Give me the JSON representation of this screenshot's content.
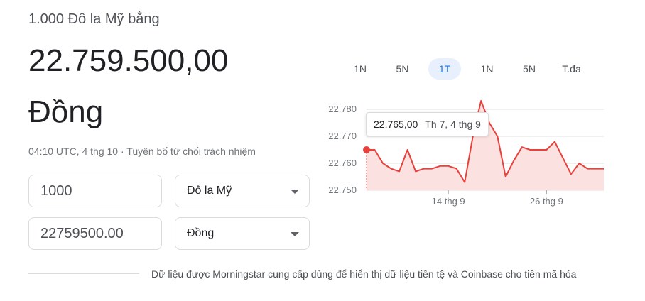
{
  "header": {
    "subtitle": "1.000 Đô la Mỹ bằng",
    "amount": "22.759.500,00",
    "currency_name": "Đồng"
  },
  "meta": {
    "timestamp": "04:10 UTC, 4 thg 10",
    "separator": " · ",
    "disclaimer": "Tuyên bố từ chối trách nhiệm"
  },
  "converter": {
    "from_value": "1000",
    "from_currency": "Đô la Mỹ",
    "to_value": "22759500.00",
    "to_currency": "Đồng"
  },
  "range_tabs": [
    {
      "label": "1N",
      "active": false
    },
    {
      "label": "5N",
      "active": false
    },
    {
      "label": "1T",
      "active": true
    },
    {
      "label": "1N",
      "active": false
    },
    {
      "label": "5N",
      "active": false
    },
    {
      "label": "T.đa",
      "active": false
    }
  ],
  "tooltip": {
    "value": "22.765,00",
    "date": "Th 7, 4 thg 9"
  },
  "colors": {
    "line": "#e8413c",
    "fill": "#fbe1df",
    "accent": "#1a73e8",
    "grid": "#e0e0e0"
  },
  "chart_data": {
    "type": "area",
    "y_tick_labels": [
      "22.780",
      "22.770",
      "22.760",
      "22.750"
    ],
    "y_ticks": [
      22780,
      22770,
      22760,
      22750
    ],
    "x_tick_labels": [
      "14 thg 9",
      "26 thg 9"
    ],
    "x_tick_index": [
      10,
      22
    ],
    "ylim": [
      22750,
      22780
    ],
    "values": [
      22765,
      22765,
      22760,
      22758,
      22757,
      22765,
      22757,
      22758,
      22758,
      22759,
      22759,
      22758,
      22753,
      22770,
      22785,
      22775,
      22770,
      22755,
      22761,
      22766,
      22765,
      22765,
      22765,
      22768,
      22762,
      22756,
      22760,
      22758,
      22758,
      22758
    ],
    "highlight_index": 0,
    "grid": true
  },
  "footer": {
    "source_text": "Dữ liệu được Morningstar cung cấp dùng để hiển thị dữ liệu tiền tệ và Coinbase cho tiền mã hóa"
  }
}
